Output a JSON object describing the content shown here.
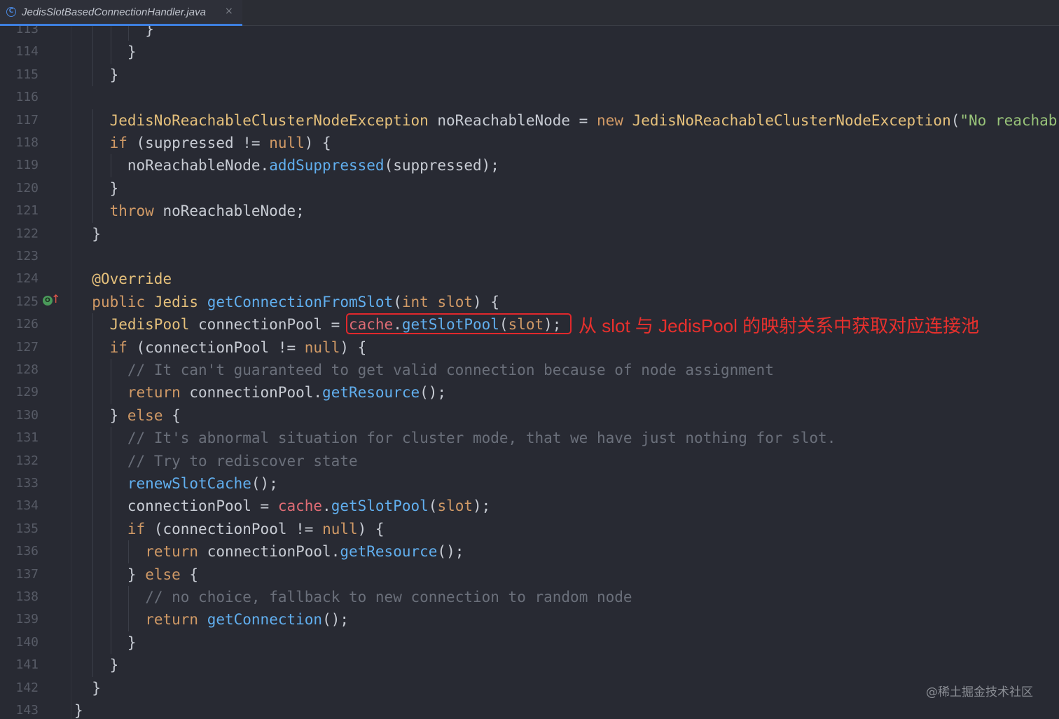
{
  "tab": {
    "title": "JedisSlotBasedConnectionHandler.java",
    "icon": "class-c-icon",
    "icon_glyph": "C",
    "close_glyph": "×"
  },
  "colors": {
    "background": "#282a33",
    "keyword": "#d19a66",
    "type": "#e5c07b",
    "method": "#61afef",
    "comment": "#6a6f7a",
    "string": "#98c379",
    "highlight": "#e1282c"
  },
  "gutter_marker": {
    "line": "125",
    "icon": "override-implements-icon",
    "glyph": "O",
    "arrow": "↑"
  },
  "annotation": {
    "text": "从 slot 与 JedisPool 的映射关系中获取对应连接池"
  },
  "watermark": "@稀土掘金技术社区",
  "lines": [
    {
      "num": "113",
      "indent": 4,
      "tokens": [
        {
          "t": "}",
          "c": ""
        }
      ]
    },
    {
      "num": "114",
      "indent": 3,
      "tokens": [
        {
          "t": "}",
          "c": ""
        }
      ]
    },
    {
      "num": "115",
      "indent": 2,
      "tokens": [
        {
          "t": "}",
          "c": ""
        }
      ]
    },
    {
      "num": "116",
      "indent": 0,
      "tokens": []
    },
    {
      "num": "117",
      "indent": 2,
      "tokens": [
        {
          "t": "JedisNoReachableClusterNodeException",
          "c": "type"
        },
        {
          "t": " noReachableNode = ",
          "c": ""
        },
        {
          "t": "new",
          "c": "kw"
        },
        {
          "t": " ",
          "c": ""
        },
        {
          "t": "JedisNoReachableClusterNodeException",
          "c": "type"
        },
        {
          "t": "(",
          "c": ""
        },
        {
          "t": "\"No reachab",
          "c": "str"
        }
      ]
    },
    {
      "num": "118",
      "indent": 2,
      "tokens": [
        {
          "t": "if",
          "c": "kw"
        },
        {
          "t": " (suppressed != ",
          "c": ""
        },
        {
          "t": "null",
          "c": "kw"
        },
        {
          "t": ") {",
          "c": ""
        }
      ]
    },
    {
      "num": "119",
      "indent": 3,
      "tokens": [
        {
          "t": "noReachableNode.",
          "c": ""
        },
        {
          "t": "addSuppressed",
          "c": "fn"
        },
        {
          "t": "(suppressed);",
          "c": ""
        }
      ]
    },
    {
      "num": "120",
      "indent": 2,
      "tokens": [
        {
          "t": "}",
          "c": ""
        }
      ]
    },
    {
      "num": "121",
      "indent": 2,
      "tokens": [
        {
          "t": "throw",
          "c": "kw"
        },
        {
          "t": " noReachableNode;",
          "c": ""
        }
      ]
    },
    {
      "num": "122",
      "indent": 1,
      "tokens": [
        {
          "t": "}",
          "c": ""
        }
      ]
    },
    {
      "num": "123",
      "indent": 0,
      "tokens": []
    },
    {
      "num": "124",
      "indent": 1,
      "tokens": [
        {
          "t": "@Override",
          "c": "ann"
        }
      ]
    },
    {
      "num": "125",
      "indent": 1,
      "tokens": [
        {
          "t": "public",
          "c": "kw"
        },
        {
          "t": " ",
          "c": ""
        },
        {
          "t": "Jedis",
          "c": "type"
        },
        {
          "t": " ",
          "c": ""
        },
        {
          "t": "getConnectionFromSlot",
          "c": "fn"
        },
        {
          "t": "(",
          "c": ""
        },
        {
          "t": "int",
          "c": "kw"
        },
        {
          "t": " ",
          "c": ""
        },
        {
          "t": "slot",
          "c": "kw"
        },
        {
          "t": ") {",
          "c": ""
        }
      ]
    },
    {
      "num": "126",
      "indent": 2,
      "tokens": [
        {
          "t": "JedisPool",
          "c": "type"
        },
        {
          "t": " connectionPool = ",
          "c": ""
        },
        {
          "t": "cache",
          "c": "field"
        },
        {
          "t": ".",
          "c": ""
        },
        {
          "t": "getSlotPool",
          "c": "fn"
        },
        {
          "t": "(",
          "c": ""
        },
        {
          "t": "slot",
          "c": "kw"
        },
        {
          "t": ");",
          "c": ""
        }
      ]
    },
    {
      "num": "127",
      "indent": 2,
      "tokens": [
        {
          "t": "if",
          "c": "kw"
        },
        {
          "t": " (connectionPool != ",
          "c": ""
        },
        {
          "t": "null",
          "c": "kw"
        },
        {
          "t": ") {",
          "c": ""
        }
      ]
    },
    {
      "num": "128",
      "indent": 3,
      "tokens": [
        {
          "t": "// It can't guaranteed to get valid connection because of node assignment",
          "c": "cm"
        }
      ]
    },
    {
      "num": "129",
      "indent": 3,
      "tokens": [
        {
          "t": "return",
          "c": "kw"
        },
        {
          "t": " connectionPool.",
          "c": ""
        },
        {
          "t": "getResource",
          "c": "fn"
        },
        {
          "t": "();",
          "c": ""
        }
      ]
    },
    {
      "num": "130",
      "indent": 2,
      "tokens": [
        {
          "t": "} ",
          "c": ""
        },
        {
          "t": "else",
          "c": "kw"
        },
        {
          "t": " {",
          "c": ""
        }
      ]
    },
    {
      "num": "131",
      "indent": 3,
      "tokens": [
        {
          "t": "// It's abnormal situation for cluster mode, that we have just nothing for slot.",
          "c": "cm"
        }
      ]
    },
    {
      "num": "132",
      "indent": 3,
      "tokens": [
        {
          "t": "// Try to rediscover state",
          "c": "cm"
        }
      ]
    },
    {
      "num": "133",
      "indent": 3,
      "tokens": [
        {
          "t": "renewSlotCache",
          "c": "fn"
        },
        {
          "t": "();",
          "c": ""
        }
      ]
    },
    {
      "num": "134",
      "indent": 3,
      "tokens": [
        {
          "t": "connectionPool = ",
          "c": ""
        },
        {
          "t": "cache",
          "c": "field"
        },
        {
          "t": ".",
          "c": ""
        },
        {
          "t": "getSlotPool",
          "c": "fn"
        },
        {
          "t": "(",
          "c": ""
        },
        {
          "t": "slot",
          "c": "kw"
        },
        {
          "t": ");",
          "c": ""
        }
      ]
    },
    {
      "num": "135",
      "indent": 3,
      "tokens": [
        {
          "t": "if",
          "c": "kw"
        },
        {
          "t": " (connectionPool != ",
          "c": ""
        },
        {
          "t": "null",
          "c": "kw"
        },
        {
          "t": ") {",
          "c": ""
        }
      ]
    },
    {
      "num": "136",
      "indent": 4,
      "tokens": [
        {
          "t": "return",
          "c": "kw"
        },
        {
          "t": " connectionPool.",
          "c": ""
        },
        {
          "t": "getResource",
          "c": "fn"
        },
        {
          "t": "();",
          "c": ""
        }
      ]
    },
    {
      "num": "137",
      "indent": 3,
      "tokens": [
        {
          "t": "} ",
          "c": ""
        },
        {
          "t": "else",
          "c": "kw"
        },
        {
          "t": " {",
          "c": ""
        }
      ]
    },
    {
      "num": "138",
      "indent": 4,
      "tokens": [
        {
          "t": "// no choice, fallback to new connection to random node",
          "c": "cm"
        }
      ]
    },
    {
      "num": "139",
      "indent": 4,
      "tokens": [
        {
          "t": "return",
          "c": "kw"
        },
        {
          "t": " ",
          "c": ""
        },
        {
          "t": "getConnection",
          "c": "fn"
        },
        {
          "t": "();",
          "c": ""
        }
      ]
    },
    {
      "num": "140",
      "indent": 3,
      "tokens": [
        {
          "t": "}",
          "c": ""
        }
      ]
    },
    {
      "num": "141",
      "indent": 2,
      "tokens": [
        {
          "t": "}",
          "c": ""
        }
      ]
    },
    {
      "num": "142",
      "indent": 1,
      "tokens": [
        {
          "t": "}",
          "c": ""
        }
      ]
    },
    {
      "num": "143",
      "indent": 0,
      "tokens": [
        {
          "t": "}",
          "c": ""
        }
      ]
    }
  ]
}
